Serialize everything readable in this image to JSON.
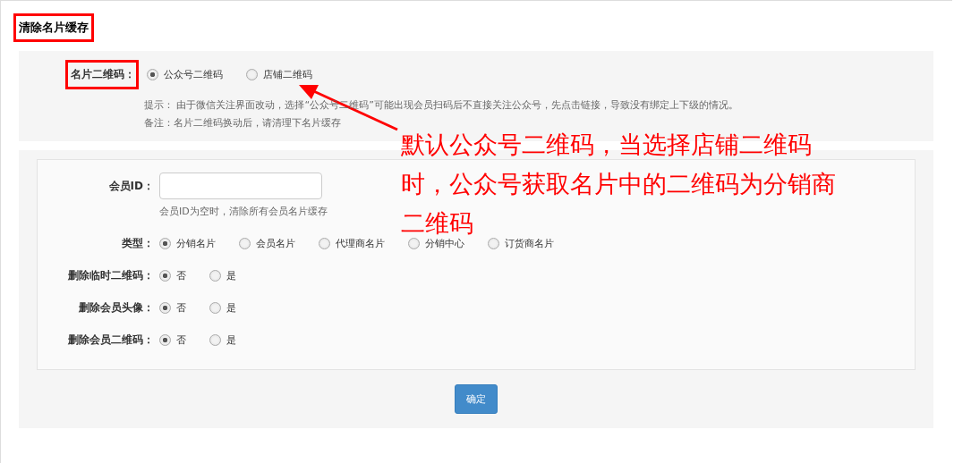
{
  "title": "清除名片缓存",
  "card_qr": {
    "label": "名片二维码：",
    "options": [
      {
        "label": "公众号二维码",
        "selected": true
      },
      {
        "label": "店铺二维码",
        "selected": false
      }
    ],
    "hints": [
      "提示： 由于微信关注界面改动，选择“公众号二维码”可能出现会员扫码后不直接关注公众号，先点击链接，导致没有绑定上下级的情况。",
      "备注：名片二维码换动后，请清理下名片缓存"
    ]
  },
  "annotation": [
    "默认公众号二维码，当选择店铺二维码",
    "时，公众号获取名片中的二维码为分销商",
    "二维码"
  ],
  "member_id": {
    "label": "会员ID：",
    "hint": "会员ID为空时，清除所有会员名片缓存"
  },
  "radio_rows": [
    {
      "label": "类型：",
      "options": [
        {
          "label": "分销名片",
          "selected": true
        },
        {
          "label": "会员名片",
          "selected": false
        },
        {
          "label": "代理商名片",
          "selected": false
        },
        {
          "label": "分销中心",
          "selected": false
        },
        {
          "label": "订货商名片",
          "selected": false
        }
      ]
    },
    {
      "label": "删除临时二维码：",
      "options": [
        {
          "label": "否",
          "selected": true
        },
        {
          "label": "是",
          "selected": false
        }
      ]
    },
    {
      "label": "删除会员头像：",
      "options": [
        {
          "label": "否",
          "selected": true
        },
        {
          "label": "是",
          "selected": false
        }
      ]
    },
    {
      "label": "删除会员二维码：",
      "options": [
        {
          "label": "否",
          "selected": true
        },
        {
          "label": "是",
          "selected": false
        }
      ]
    }
  ],
  "submit": "确定"
}
